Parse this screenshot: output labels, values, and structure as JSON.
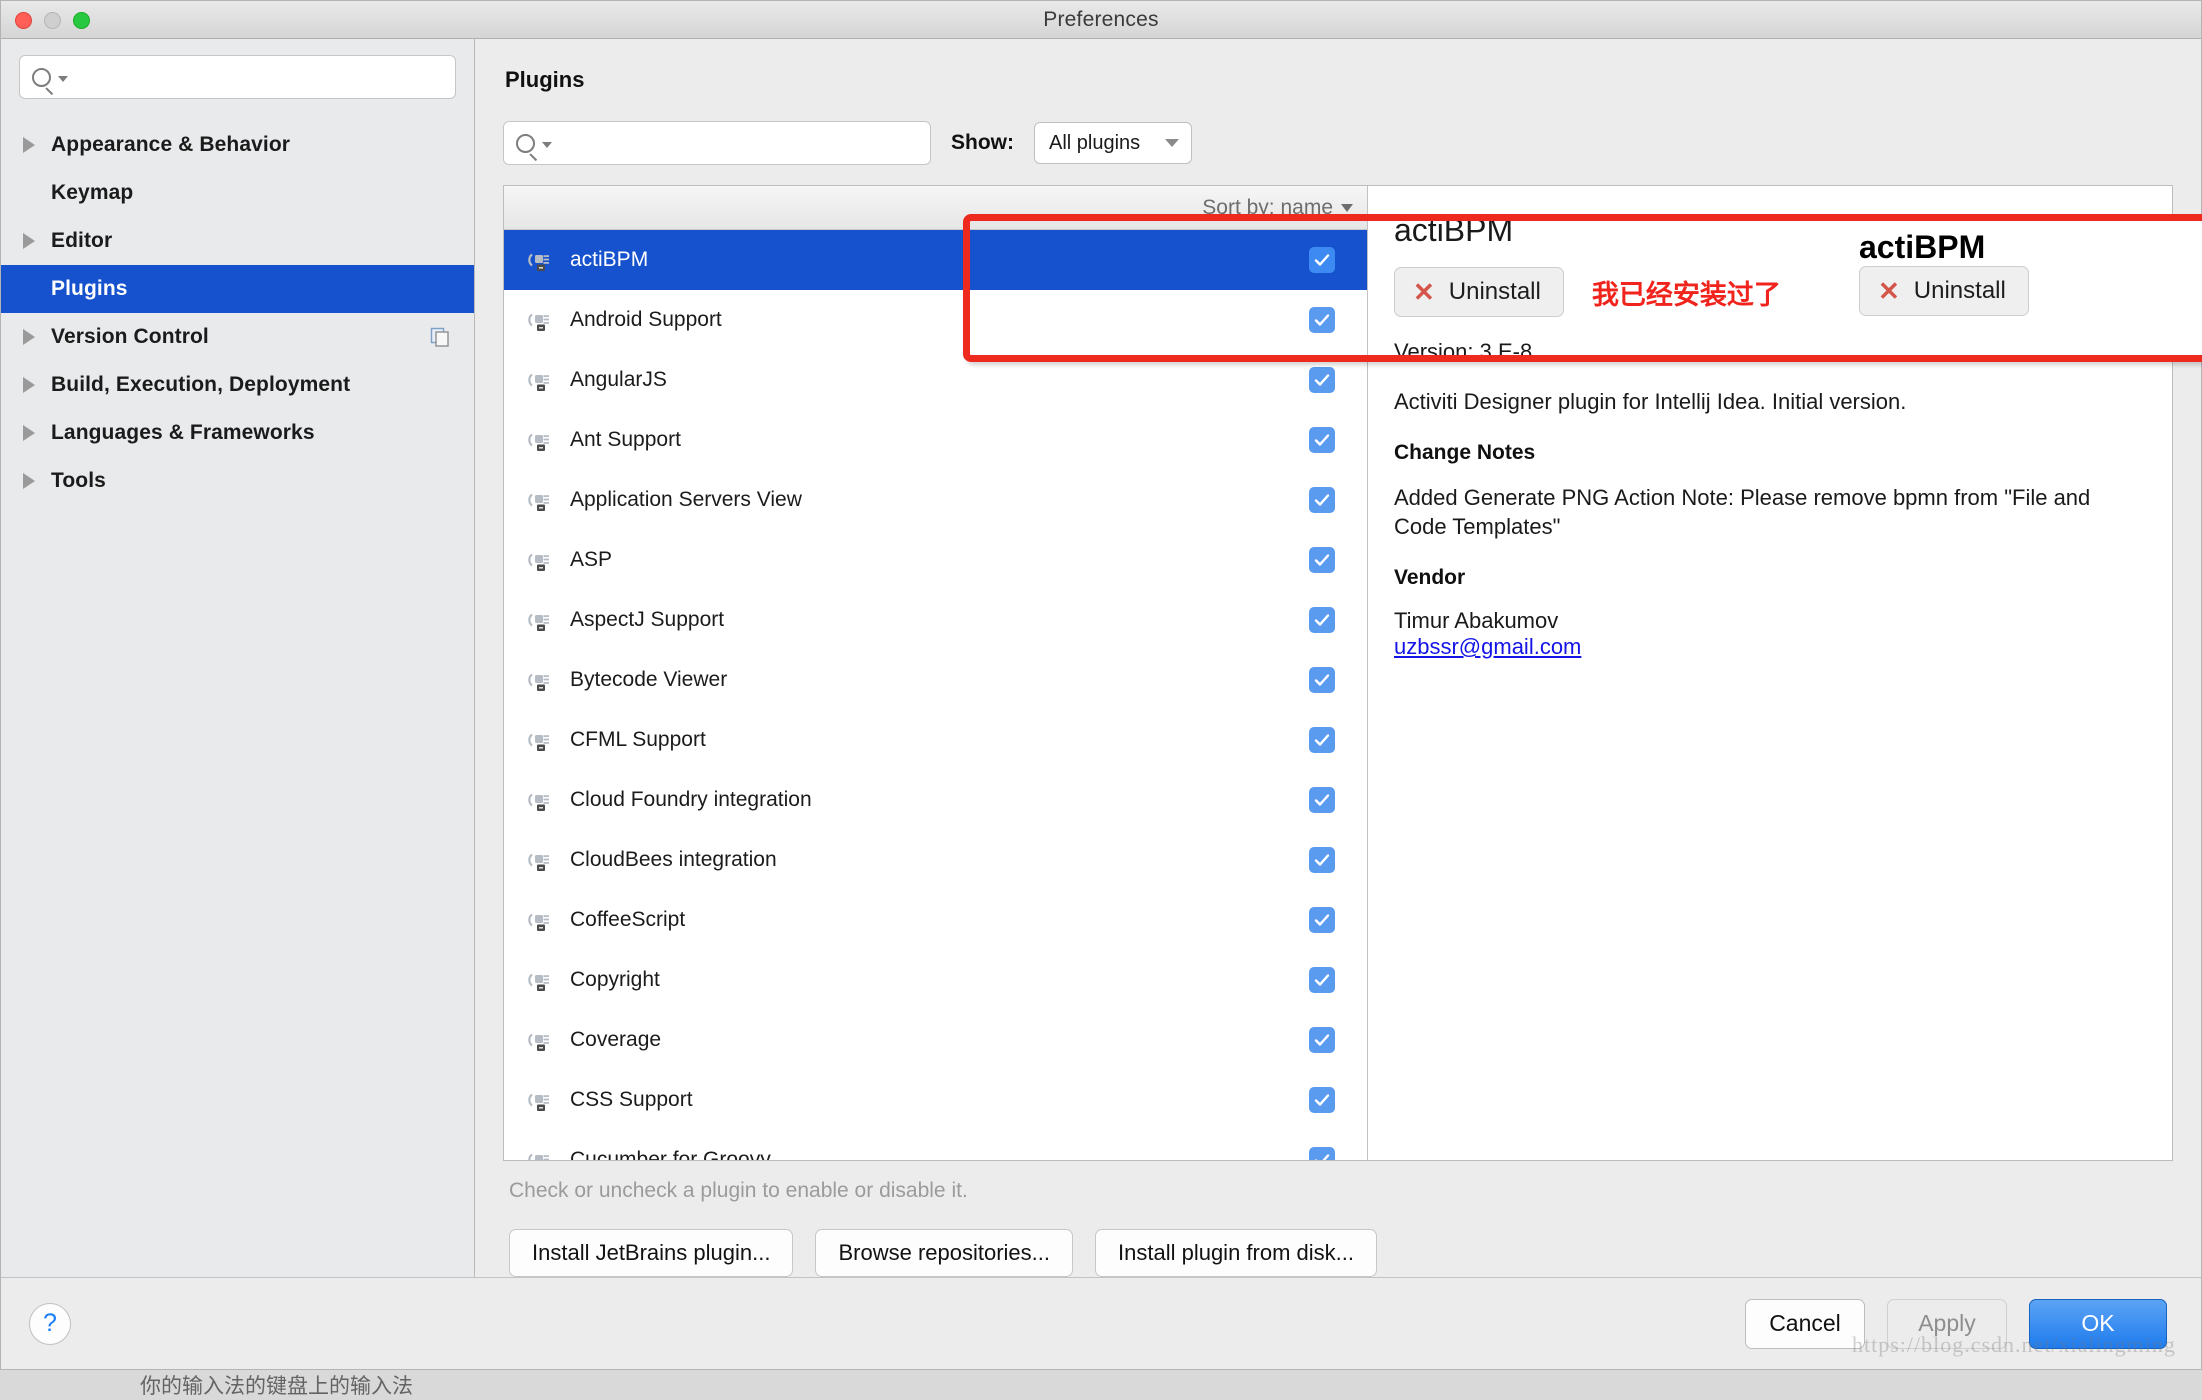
{
  "window": {
    "title": "Preferences",
    "traffic_lights": [
      "close-button",
      "minimize-button",
      "maximize-button"
    ]
  },
  "sidebar": {
    "search": {
      "value": "",
      "placeholder": ""
    },
    "items": [
      {
        "label": "Appearance & Behavior",
        "expandable": true,
        "selected": false,
        "badge": null
      },
      {
        "label": "Keymap",
        "expandable": false,
        "selected": false,
        "badge": null
      },
      {
        "label": "Editor",
        "expandable": true,
        "selected": false,
        "badge": null
      },
      {
        "label": "Plugins",
        "expandable": false,
        "selected": true,
        "badge": null
      },
      {
        "label": "Version Control",
        "expandable": true,
        "selected": false,
        "badge": "copy-icon"
      },
      {
        "label": "Build, Execution, Deployment",
        "expandable": true,
        "selected": false,
        "badge": null
      },
      {
        "label": "Languages & Frameworks",
        "expandable": true,
        "selected": false,
        "badge": null
      },
      {
        "label": "Tools",
        "expandable": true,
        "selected": false,
        "badge": null
      }
    ]
  },
  "main": {
    "page_title": "Plugins",
    "search": {
      "value": "",
      "placeholder": ""
    },
    "show_label": "Show:",
    "show_value": "All plugins",
    "sort_by": "Sort by: name",
    "hint": "Check or uncheck a plugin to enable or disable it.",
    "install_buttons": [
      "Install JetBrains plugin...",
      "Browse repositories...",
      "Install plugin from disk..."
    ]
  },
  "plugins": [
    {
      "name": "actiBPM",
      "checked": true,
      "selected": true
    },
    {
      "name": "Android Support",
      "checked": true,
      "selected": false
    },
    {
      "name": "AngularJS",
      "checked": true,
      "selected": false
    },
    {
      "name": "Ant Support",
      "checked": true,
      "selected": false
    },
    {
      "name": "Application Servers View",
      "checked": true,
      "selected": false
    },
    {
      "name": "ASP",
      "checked": true,
      "selected": false
    },
    {
      "name": "AspectJ Support",
      "checked": true,
      "selected": false
    },
    {
      "name": "Bytecode Viewer",
      "checked": true,
      "selected": false
    },
    {
      "name": "CFML Support",
      "checked": true,
      "selected": false
    },
    {
      "name": "Cloud Foundry integration",
      "checked": true,
      "selected": false
    },
    {
      "name": "CloudBees integration",
      "checked": true,
      "selected": false
    },
    {
      "name": "CoffeeScript",
      "checked": true,
      "selected": false
    },
    {
      "name": "Copyright",
      "checked": true,
      "selected": false
    },
    {
      "name": "Coverage",
      "checked": true,
      "selected": false
    },
    {
      "name": "CSS Support",
      "checked": true,
      "selected": false
    },
    {
      "name": "Cucumber for Groovy",
      "checked": true,
      "selected": false
    }
  ],
  "detail": {
    "title": "actiBPM",
    "uninstall_label": "Uninstall",
    "version": "Version: 3.E-8",
    "description": "Activiti Designer plugin for Intellij Idea. Initial version.",
    "change_notes_head": "Change Notes",
    "change_notes_body": "Added Generate PNG Action Note: Please remove bpmn from \"File and Code Templates\"",
    "vendor_head": "Vendor",
    "vendor_name": "Timur Abakumov",
    "vendor_email": "uzbssr@gmail.com"
  },
  "annotation": {
    "text": "我已经安装过了",
    "color": "#ee2a1e"
  },
  "footer": {
    "help_label": "?",
    "cancel_label": "Cancel",
    "apply_label": "Apply",
    "ok_label": "OK"
  },
  "watermarks": {
    "bottom_right": "https://blog.csdn.net/xialingming",
    "bottom_edge": "你的输入法的键盘上的输入法"
  }
}
